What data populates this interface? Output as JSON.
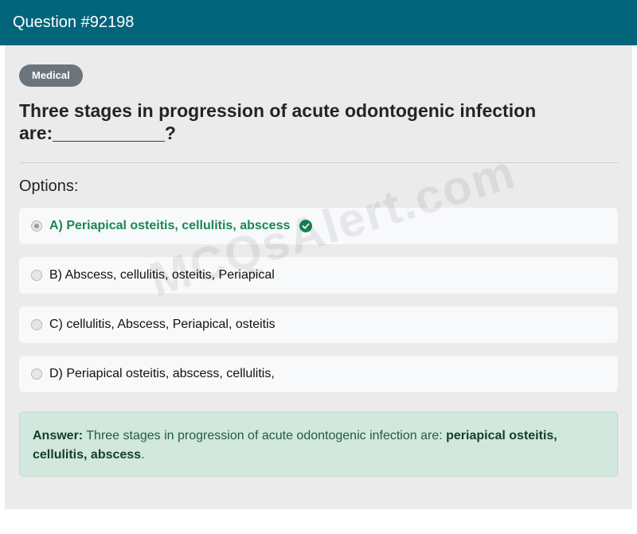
{
  "header": {
    "title": "Question #92198"
  },
  "badge": "Medical",
  "question": "Three stages in progression of acute odontogenic infection are:___________?",
  "options_label": "Options:",
  "options": [
    {
      "text": "A) Periapical osteitis, cellulitis, abscess",
      "selected": true,
      "correct": true
    },
    {
      "text": "B) Abscess, cellulitis, osteitis, Periapical",
      "selected": false,
      "correct": false
    },
    {
      "text": "C) cellulitis, Abscess, Periapical, osteitis",
      "selected": false,
      "correct": false
    },
    {
      "text": "D) Periapical osteitis, abscess, cellulitis,",
      "selected": false,
      "correct": false
    }
  ],
  "answer": {
    "label": "Answer:",
    "text": "Three stages in progression of acute odontogenic infection are:",
    "highlight": "periapical osteitis, cellulitis, abscess",
    "end": "."
  },
  "watermark": "MCQsAlert.com",
  "colors": {
    "header": "#03657b",
    "correct": "#198754",
    "answer_bg": "#d2e7dd"
  }
}
